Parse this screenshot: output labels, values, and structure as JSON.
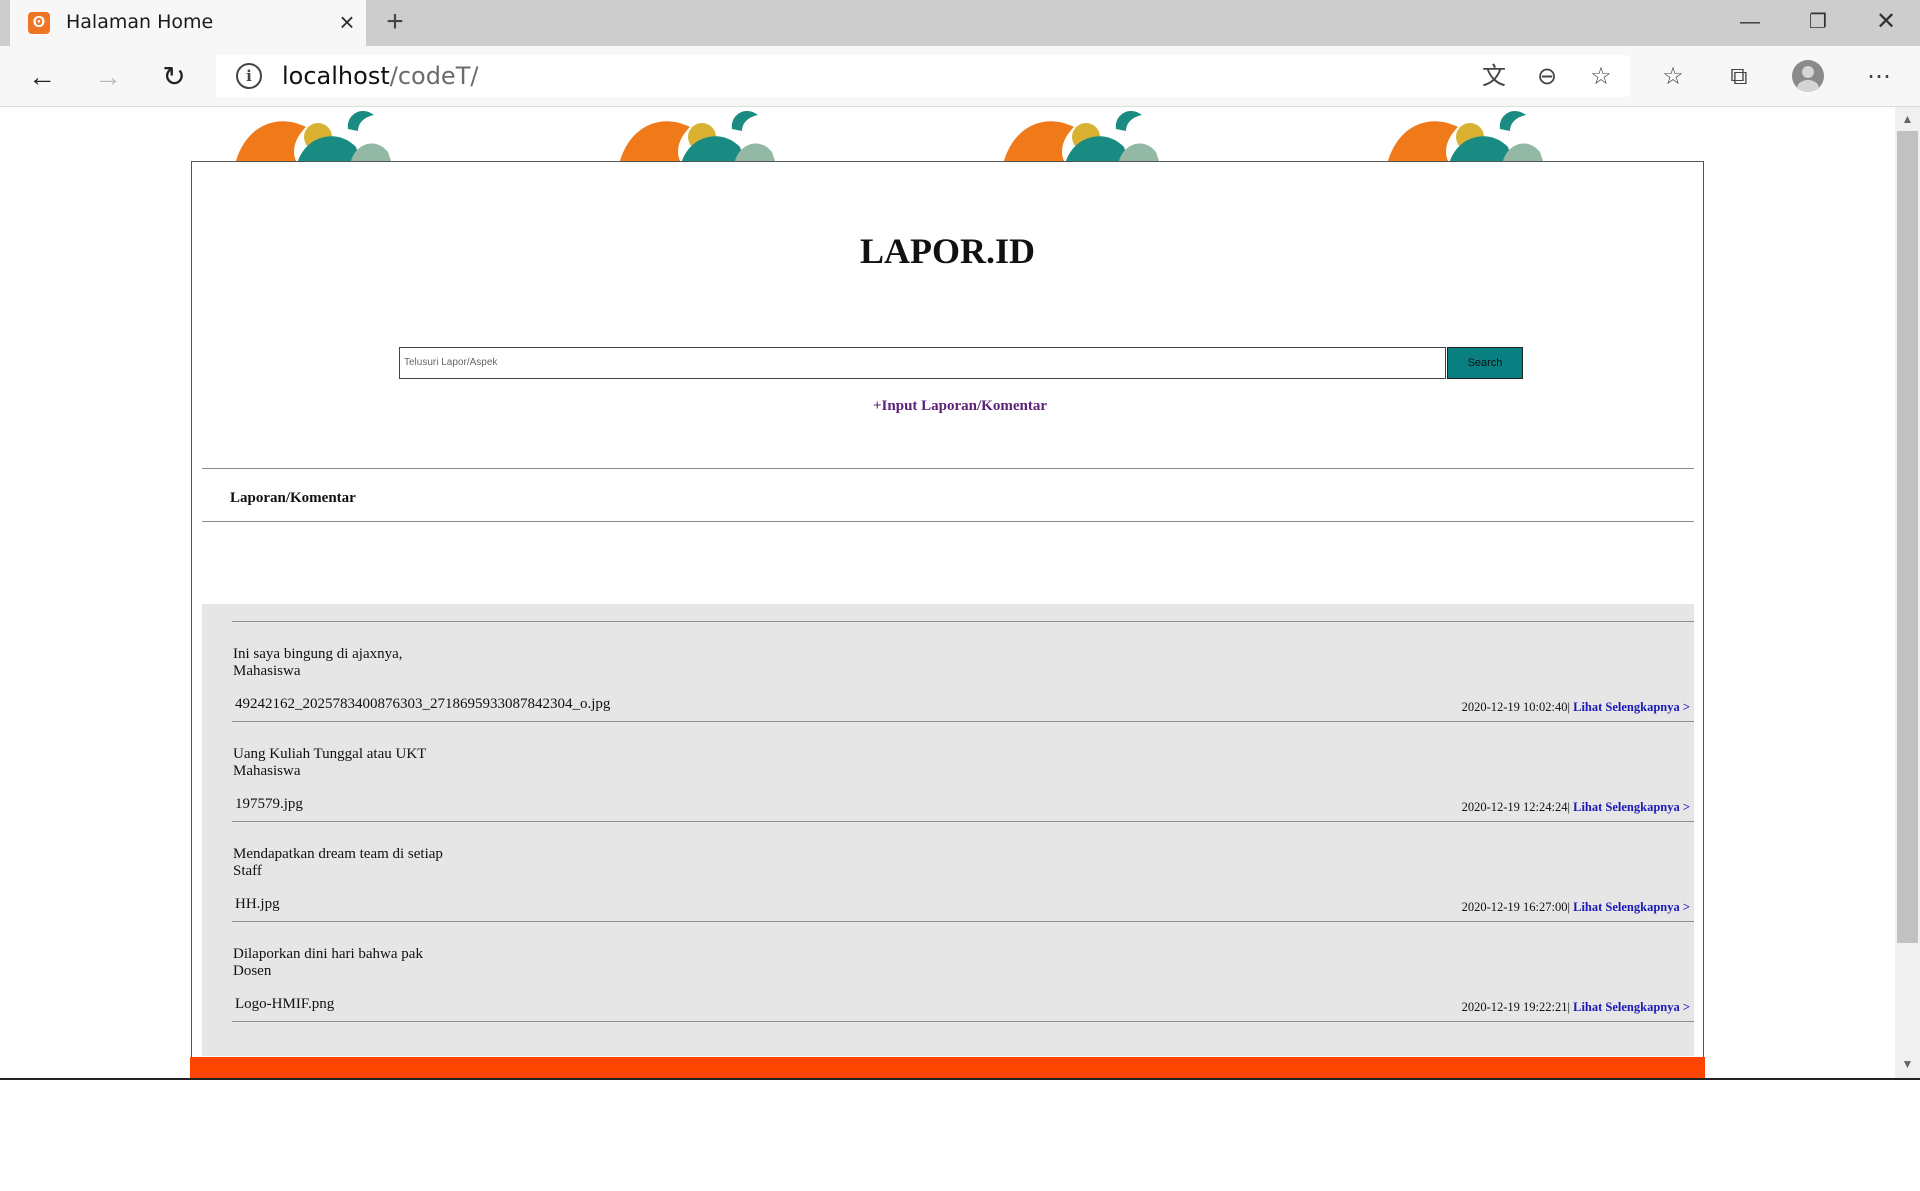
{
  "browser": {
    "tab_title": "Halaman Home",
    "url_host": "localhost",
    "url_path": "/codeT/",
    "icons": [
      "back-icon",
      "forward-icon",
      "refresh-icon",
      "info-icon",
      "translate-icon",
      "zoom-out-icon",
      "star-icon",
      "favorites-icon",
      "collections-icon",
      "profile-icon",
      "more-icon"
    ]
  },
  "page": {
    "title": "LAPOR.ID",
    "search_placeholder": "Telusuri Lapor/Aspek",
    "search_button": "Search",
    "input_link": "+Input Laporan/Komentar",
    "section_title": "Laporan/Komentar",
    "link_label": "Lihat Selengkapnya >",
    "accent_color": "#0a7f82",
    "footer_color": "#fd4501"
  },
  "reports": [
    {
      "title": "Ini saya bingung di ajaxnya,",
      "role": "Mahasiswa",
      "file": "49242162_2025783400876303_2718695933087842304_o.jpg",
      "date": "2020-12-19 10:02:40"
    },
    {
      "title": "Uang Kuliah Tunggal atau UKT",
      "role": "Mahasiswa",
      "file": "197579.jpg",
      "date": "2020-12-19 12:24:24"
    },
    {
      "title": "Mendapatkan dream team di setiap",
      "role": "Staff",
      "file": "HH.jpg",
      "date": "2020-12-19 16:27:00"
    },
    {
      "title": "Dilaporkan dini hari bahwa pak",
      "role": "Dosen",
      "file": "Logo-HMIF.png",
      "date": "2020-12-19 19:22:21"
    }
  ]
}
